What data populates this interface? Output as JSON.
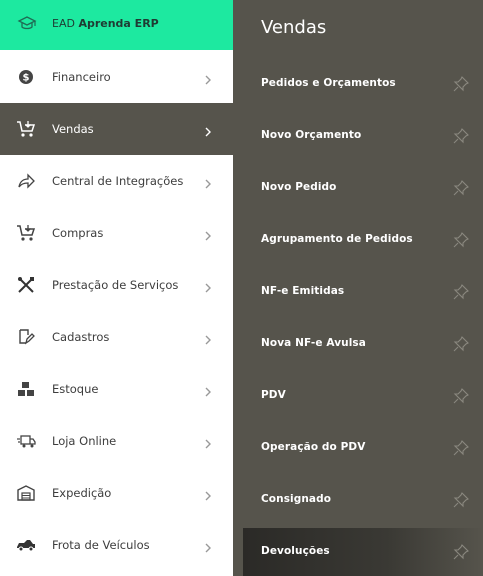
{
  "brand": {
    "prefix": "EAD",
    "name": "Aprenda ERP"
  },
  "sidebar": {
    "items": [
      {
        "label": "Financeiro",
        "icon": "dollar-icon"
      },
      {
        "label": "Vendas",
        "icon": "cart-icon"
      },
      {
        "label": "Central de Integrações",
        "icon": "share-icon"
      },
      {
        "label": "Compras",
        "icon": "cart-icon"
      },
      {
        "label": "Prestação de Serviços",
        "icon": "tools-icon"
      },
      {
        "label": "Cadastros",
        "icon": "edit-icon"
      },
      {
        "label": "Estoque",
        "icon": "boxes-icon"
      },
      {
        "label": "Loja Online",
        "icon": "delivery-truck-icon"
      },
      {
        "label": "Expedição",
        "icon": "warehouse-icon"
      },
      {
        "label": "Frota de Veículos",
        "icon": "car-icon"
      }
    ]
  },
  "submenu": {
    "title": "Vendas",
    "items": [
      {
        "label": "Pedidos e Orçamentos"
      },
      {
        "label": "Novo Orçamento"
      },
      {
        "label": "Novo Pedido"
      },
      {
        "label": "Agrupamento de Pedidos"
      },
      {
        "label": "NF-e Emitidas"
      },
      {
        "label": "Nova NF-e Avulsa"
      },
      {
        "label": "PDV"
      },
      {
        "label": "Operação do PDV"
      },
      {
        "label": "Consignado"
      },
      {
        "label": "Devoluções"
      }
    ]
  },
  "colors": {
    "brand": "#1de9a0",
    "active": "#56544c",
    "submenu_bg": "#56544c"
  }
}
